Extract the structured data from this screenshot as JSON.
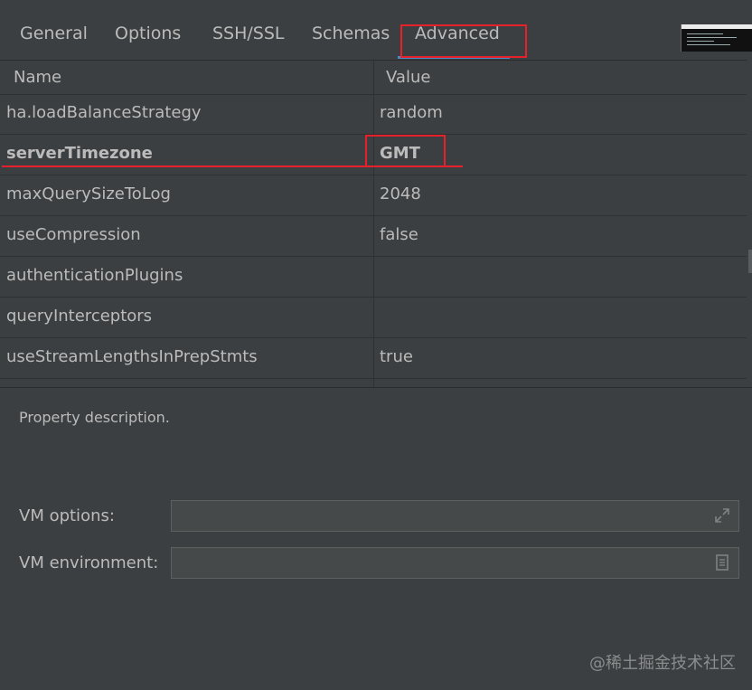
{
  "tabs": [
    {
      "label": "General"
    },
    {
      "label": "Options"
    },
    {
      "label": "SSH/SSL"
    },
    {
      "label": "Schemas"
    },
    {
      "label": "Advanced",
      "active": true
    }
  ],
  "table": {
    "headers": {
      "name": "Name",
      "value": "Value"
    },
    "rows": [
      {
        "name": "ha.loadBalanceStrategy",
        "value": "random"
      },
      {
        "name": "serverTimezone",
        "value": "GMT"
      },
      {
        "name": "maxQuerySizeToLog",
        "value": "2048"
      },
      {
        "name": "useCompression",
        "value": "false"
      },
      {
        "name": "authenticationPlugins",
        "value": ""
      },
      {
        "name": "queryInterceptors",
        "value": ""
      },
      {
        "name": "useStreamLengthsInPrepStmts",
        "value": "true"
      }
    ]
  },
  "description": "Property description.",
  "vm": {
    "options_label": "VM options:",
    "options_value": "",
    "environment_label": "VM environment:",
    "environment_value": ""
  },
  "icons": {
    "expand": "expand-icon",
    "list": "list-icon"
  },
  "watermark": "@稀土掘金技术社区",
  "colors": {
    "background": "#3c3f41",
    "text": "#bbbbbb",
    "highlight": "#e8202a",
    "tab_active": "#4a88c7"
  }
}
